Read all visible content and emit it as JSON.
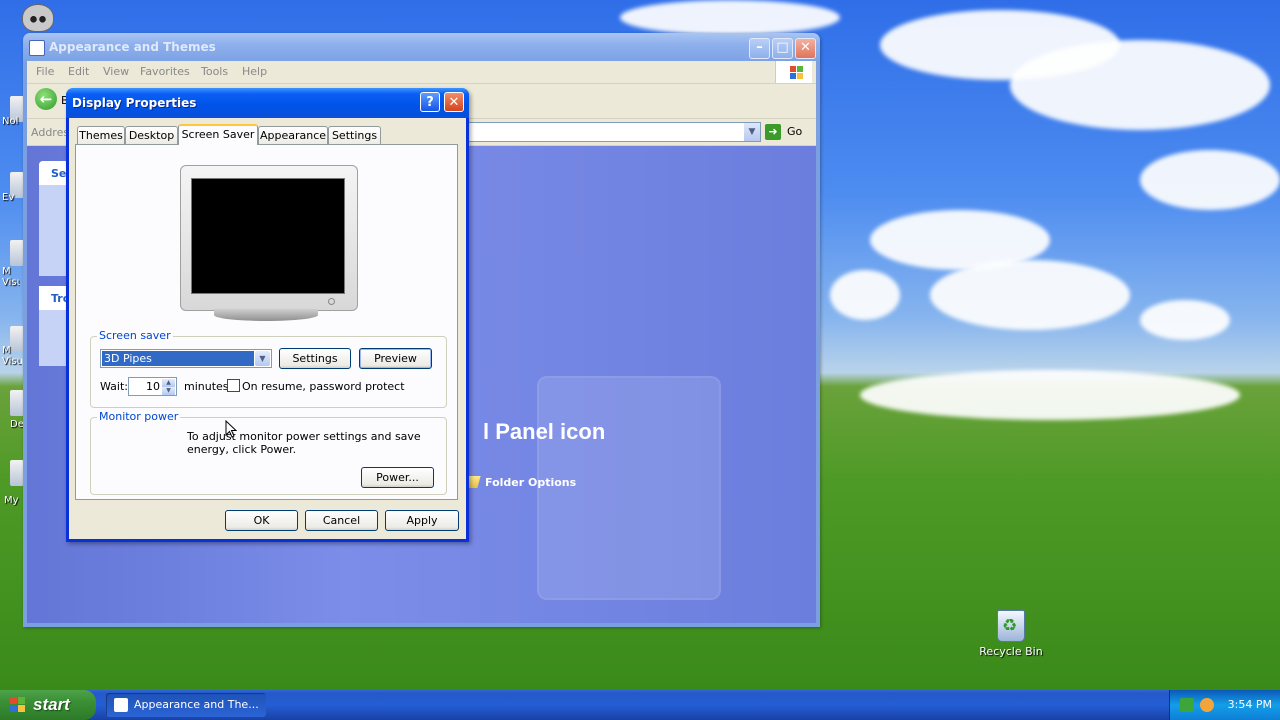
{
  "desktop": {
    "recycle_bin_label": "Recycle Bin",
    "left_icon_fragments": [
      "Nol",
      "Ev",
      "M Visu",
      "M Visu",
      "De",
      "My"
    ]
  },
  "explorer": {
    "title": "Appearance and Themes",
    "menu": [
      "File",
      "Edit",
      "View",
      "Favorites",
      "Tools",
      "Help"
    ],
    "back_label": "B",
    "address_label": "Address",
    "go_label": "Go",
    "see_also_fragment": "Se",
    "troubleshooters_fragment": "Tro",
    "heading_fragment": "l Panel icon",
    "folder_options": "Folder Options"
  },
  "dialog": {
    "title": "Display Properties",
    "tabs": [
      "Themes",
      "Desktop",
      "Screen Saver",
      "Appearance",
      "Settings"
    ],
    "active_tab": "Screen Saver",
    "screen_saver": {
      "group_label": "Screen saver",
      "selected": "3D Pipes",
      "settings_button": "Settings",
      "preview_button": "Preview",
      "wait_label": "Wait:",
      "wait_value": "10",
      "minutes_label": "minutes",
      "password_label": "On resume, password protect",
      "password_checked": false
    },
    "monitor_power": {
      "group_label": "Monitor power",
      "description": "To adjust monitor power settings and save energy, click Power.",
      "power_button": "Power..."
    },
    "ok_button": "OK",
    "cancel_button": "Cancel",
    "apply_button": "Apply"
  },
  "taskbar": {
    "start_label": "start",
    "task_button": "Appearance and The...",
    "clock": "3:54 PM"
  }
}
